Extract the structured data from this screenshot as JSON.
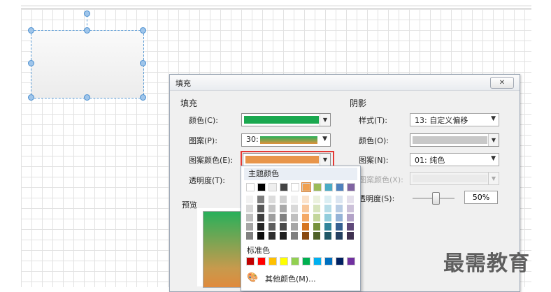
{
  "dialog": {
    "title": "填充",
    "close_label": "✕"
  },
  "fill": {
    "group_label": "填充",
    "color_label": "颜色(C):",
    "color_value": "#1aa84f",
    "pattern_label": "图案(P):",
    "pattern_number": "30:",
    "pattern_color_label": "图案颜色(E):",
    "pattern_color_value": "#e8954a",
    "transparency_label": "透明度(T):",
    "preview_label": "预览"
  },
  "shadow": {
    "group_label": "阴影",
    "style_label": "样式(T):",
    "style_value": "13: 自定义偏移",
    "color_label": "颜色(O):",
    "color_value": "#c8c8c8",
    "pattern_label": "图案(N):",
    "pattern_value": "01: 纯色",
    "pattern_color_label": "图案颜色(X):",
    "transparency_label": "透明度(S):",
    "transparency_value": "50%"
  },
  "color_popup": {
    "theme_label": "主题颜色",
    "standard_label": "标准色",
    "more_colors_label": "其他颜色(M)...",
    "theme_top_colors": [
      "#ffffff",
      "#000000",
      "#eeeeee",
      "#444444",
      "#ffffff",
      "#f0a050",
      "#9bbb59",
      "#4bacc6",
      "#4f81bd",
      "#8064a2"
    ],
    "standard_colors": [
      "#c00000",
      "#ff0000",
      "#ffc000",
      "#ffff00",
      "#92d050",
      "#00b050",
      "#00b0f0",
      "#0070c0",
      "#002060",
      "#7030a0"
    ]
  },
  "watermark": "最需教育"
}
